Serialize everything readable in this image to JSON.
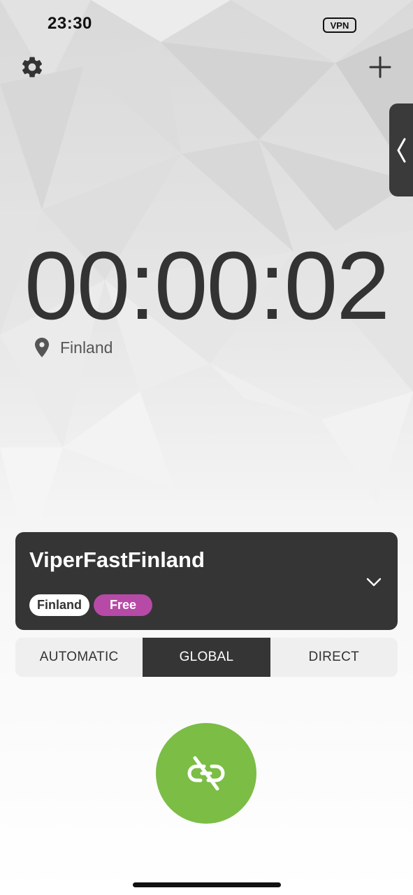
{
  "status_bar": {
    "time": "23:30",
    "vpn_badge": "VPN"
  },
  "toolbar": {
    "settings_icon": "gear-icon",
    "add_icon": "plus-icon"
  },
  "side_panel": {
    "icon": "chevron-left-icon"
  },
  "connection": {
    "timer": "00:00:02",
    "location": "Finland",
    "location_icon": "map-pin-icon"
  },
  "server": {
    "name": "ViperFastFinland",
    "country_tag": "Finland",
    "plan_tag": "Free",
    "expand_icon": "chevron-down-icon"
  },
  "modes": {
    "items": [
      "AUTOMATIC",
      "GLOBAL",
      "DIRECT"
    ],
    "selected": "GLOBAL"
  },
  "connect_button": {
    "icon": "unlink-icon"
  },
  "colors": {
    "card_bg": "#353535",
    "accent_green": "#7bbd45",
    "free_tag": "#b64aa6",
    "mode_bar_bg": "#efefef"
  }
}
